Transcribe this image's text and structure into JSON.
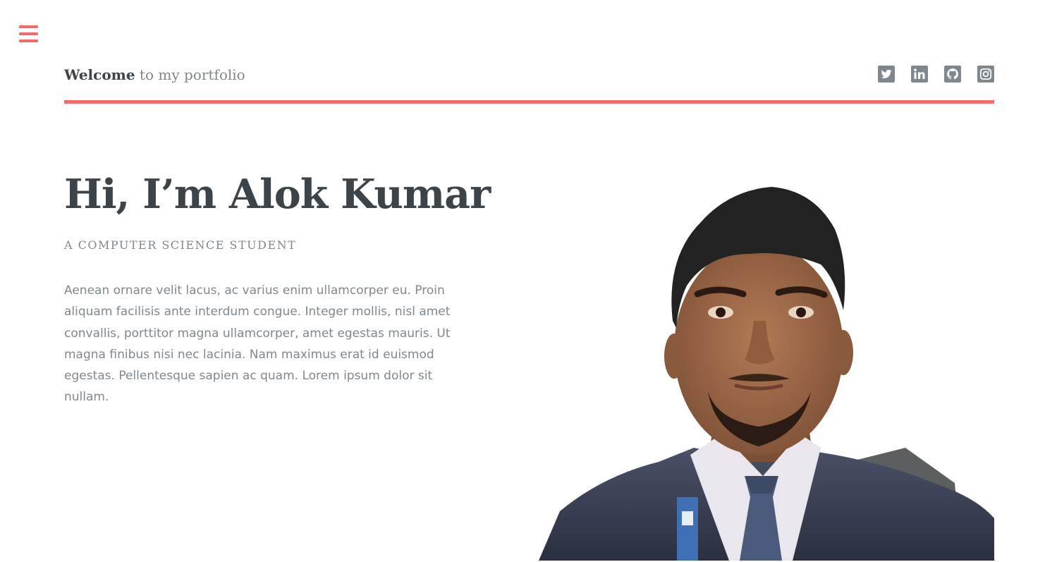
{
  "menu": {
    "icon": "hamburger-menu-icon",
    "color": "#f56a6a"
  },
  "header": {
    "logo_strong": "Welcome",
    "logo_rest": " to my portfolio",
    "accent_color": "#f56a6a",
    "social_icons": [
      "twitter-icon",
      "linkedin-icon",
      "github-icon",
      "instagram-icon"
    ]
  },
  "banner": {
    "title": "Hi, I’m Alok Kumar",
    "subtitle": "A COMPUTER SCIENCE STUDENT",
    "body": "Aenean ornare velit lacus, ac varius enim ullamcorper eu. Proin aliquam facilisis ante interdum congue. Integer mollis, nisl amet convallis, porttitor magna ullamcorper, amet egestas mauris. Ut magna finibus nisi nec lacinia. Nam maximus erat id euismod egestas. Pellentesque sapien ac quam. Lorem ipsum dolor sit nullam."
  },
  "colors": {
    "heading": "#3d4449",
    "muted": "#7f888f",
    "icon": "#7f888f",
    "background": "#ffffff"
  }
}
